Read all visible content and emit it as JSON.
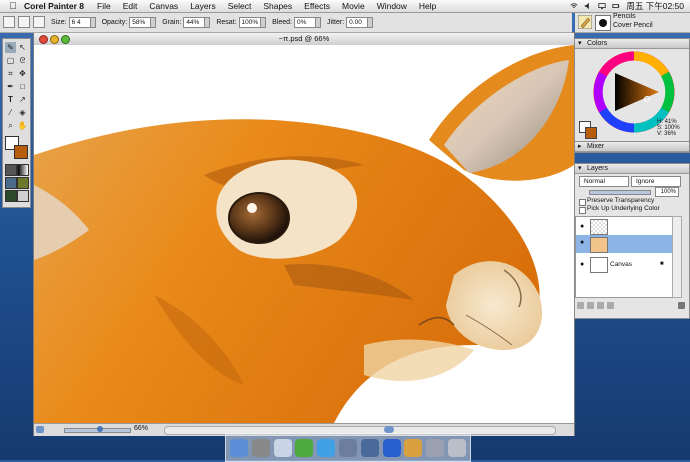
{
  "menubar": {
    "app_name": "Corel Painter 8",
    "items": [
      "File",
      "Edit",
      "Canvas",
      "Layers",
      "Select",
      "Shapes",
      "Effects",
      "Movie",
      "Window",
      "Help"
    ],
    "clock": "周五 下午02:50"
  },
  "property_bar": {
    "size_label": "Size:",
    "size_value": "6 4",
    "opacity_label": "Opacity:",
    "opacity_value": "58%",
    "grain_label": "Grain:",
    "grain_value": "44%",
    "resat_label": "Resat:",
    "resat_value": "100%",
    "bleed_label": "Bleed:",
    "bleed_value": "0%",
    "jitter_label": "Jitter:",
    "jitter_value": "0.00"
  },
  "brush_selector": {
    "category": "Pencils",
    "variant": "Cover Pencil"
  },
  "document": {
    "title": "~π.psd @ 66%",
    "zoom": "66%"
  },
  "colors_palette": {
    "title": "Colors",
    "h_readout": "H: 41%",
    "s_readout": "S: 100%",
    "v_readout": "V: 36%",
    "main_color": "#b85d0c",
    "secondary_color": "#ffffff"
  },
  "mixer_palette": {
    "title": "Mixer"
  },
  "layers_palette": {
    "title": "Layers",
    "composite_method": "Normal",
    "depth": "Ignore",
    "opacity": "100%",
    "preserve_transparency": "Preserve Transparency",
    "pick_up_color": "Pick Up Underlying Color",
    "layers": [
      {
        "name": ""
      },
      {
        "name": ""
      },
      {
        "name": "Canvas"
      }
    ]
  },
  "colors": {
    "fur_orange": "#e98a1a",
    "fur_dark": "#b8620f",
    "selection_blue": "#8db4e6"
  }
}
